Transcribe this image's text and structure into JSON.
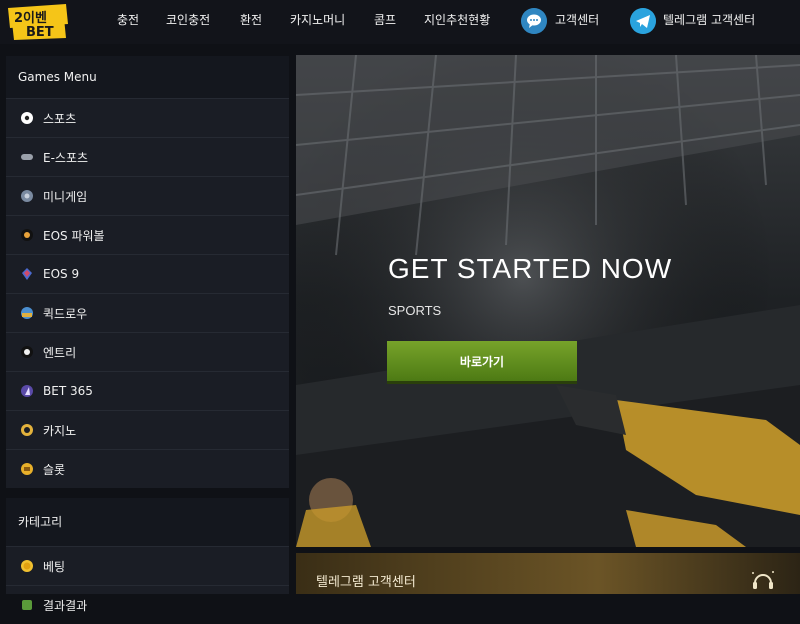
{
  "brand": {
    "logo_top": "2이벤",
    "logo_bottom": "BET"
  },
  "nav": {
    "items": [
      {
        "label": "충전"
      },
      {
        "label": "코인충전"
      },
      {
        "label": "환전"
      },
      {
        "label": "카지노머니"
      },
      {
        "label": "콤프"
      },
      {
        "label": "지인추천현황"
      }
    ],
    "support_label": "고객센터",
    "telegram_label": "텔레그램 고객센터"
  },
  "sidebar": {
    "games_header": "Games Menu",
    "games": [
      {
        "label": "스포츠",
        "icon": "soccer-ball-icon"
      },
      {
        "label": "E-스포츠",
        "icon": "gamepad-icon"
      },
      {
        "label": "미니게임",
        "icon": "mini-game-icon"
      },
      {
        "label": "EOS 파워볼",
        "icon": "powerball-icon"
      },
      {
        "label": "EOS 9",
        "icon": "eos-icon"
      },
      {
        "label": "퀵드로우",
        "icon": "quickdraw-icon"
      },
      {
        "label": "엔트리",
        "icon": "entry-ball-icon"
      },
      {
        "label": "BET 365",
        "icon": "bet365-icon"
      },
      {
        "label": "카지노",
        "icon": "casino-chip-icon"
      },
      {
        "label": "슬롯",
        "icon": "slot-icon"
      }
    ],
    "category_header": "카테고리",
    "categories": [
      {
        "label": "베팅",
        "icon": "coin-icon"
      },
      {
        "label": "결과결과",
        "icon": "result-icon"
      }
    ]
  },
  "hero": {
    "title": "GET STARTED NOW",
    "subtitle": "SPORTS",
    "button_label": "바로가기"
  },
  "banner": {
    "title": "텔레그램 고객센터"
  },
  "colors": {
    "accent_green": "#5f8c1d",
    "background": "#0f1116",
    "sidebar": "#1a1d25"
  }
}
